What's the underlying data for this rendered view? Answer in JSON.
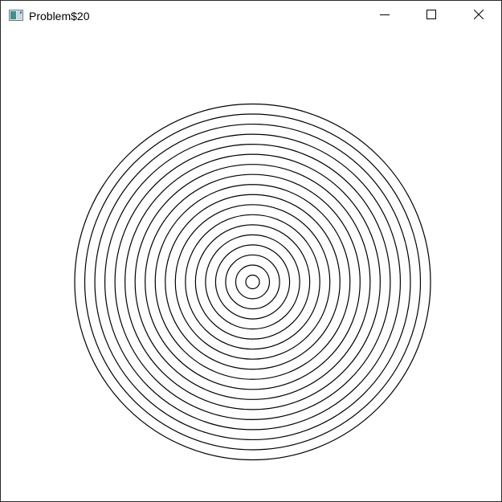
{
  "window": {
    "title": "Problem$20",
    "app_icon": "java-window-icon",
    "controls": {
      "minimize_icon": "minimize-icon",
      "maximize_icon": "maximize-icon",
      "close_icon": "close-icon"
    }
  },
  "drawing": {
    "shape": "concentric-circles",
    "ring_count": 18,
    "stroke_color": "#000000",
    "background_color": "#ffffff"
  }
}
